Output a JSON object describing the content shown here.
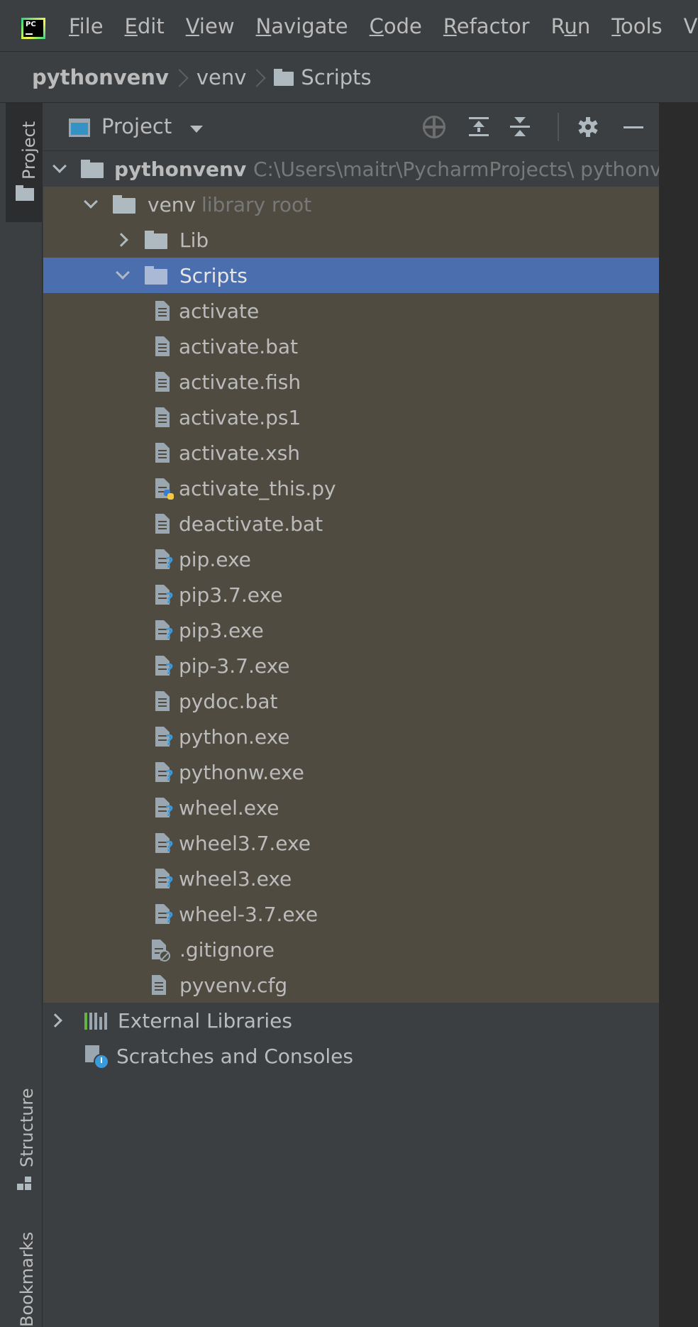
{
  "menu": {
    "logo_text": "PC",
    "items": [
      {
        "first": "F",
        "rest": "ile"
      },
      {
        "first": "E",
        "rest": "dit"
      },
      {
        "first": "V",
        "rest": "iew"
      },
      {
        "first": "N",
        "rest": "avigate"
      },
      {
        "first": "C",
        "rest": "ode"
      },
      {
        "first": "R",
        "rest": "efactor"
      },
      {
        "pre": "R",
        "first": "u",
        "rest": "n"
      },
      {
        "first": "T",
        "rest": "ools"
      },
      {
        "pre": "VC",
        "first": "S",
        "rest": ""
      }
    ]
  },
  "breadcrumb": {
    "root": "pythonvenv",
    "level1": "venv",
    "level2": "Scripts"
  },
  "strip": {
    "project_tab": "Project",
    "structure_tab": "Structure",
    "bookmarks_tab": "Bookmarks"
  },
  "panel": {
    "title": "Project"
  },
  "tree": {
    "root": {
      "name": "pythonvenv",
      "path": "C:\\Users\\maitr\\PycharmProjects\\ pythonven"
    },
    "venv": {
      "name": "venv",
      "hint": "library root"
    },
    "lib": "Lib",
    "scripts": "Scripts",
    "scripts_files": [
      {
        "name": "activate",
        "kind": "text"
      },
      {
        "name": "activate.bat",
        "kind": "text"
      },
      {
        "name": "activate.fish",
        "kind": "text"
      },
      {
        "name": "activate.ps1",
        "kind": "text"
      },
      {
        "name": "activate.xsh",
        "kind": "text"
      },
      {
        "name": "activate_this.py",
        "kind": "python"
      },
      {
        "name": "deactivate.bat",
        "kind": "text"
      },
      {
        "name": "pip.exe",
        "kind": "unknown"
      },
      {
        "name": "pip3.7.exe",
        "kind": "unknown"
      },
      {
        "name": "pip3.exe",
        "kind": "unknown"
      },
      {
        "name": "pip-3.7.exe",
        "kind": "unknown"
      },
      {
        "name": "pydoc.bat",
        "kind": "text"
      },
      {
        "name": "python.exe",
        "kind": "unknown"
      },
      {
        "name": "pythonw.exe",
        "kind": "unknown"
      },
      {
        "name": "wheel.exe",
        "kind": "unknown"
      },
      {
        "name": "wheel3.7.exe",
        "kind": "unknown"
      },
      {
        "name": "wheel3.exe",
        "kind": "unknown"
      },
      {
        "name": "wheel-3.7.exe",
        "kind": "unknown"
      }
    ],
    "gitignore": ".gitignore",
    "pyvenv": "pyvenv.cfg",
    "external_libraries": "External Libraries",
    "scratches": "Scratches and Consoles"
  },
  "colors": {
    "background": "#3c3f41",
    "venv_scope": "#4f4b41",
    "selection": "#4b6eaf",
    "editor": "#2b2b2b"
  }
}
